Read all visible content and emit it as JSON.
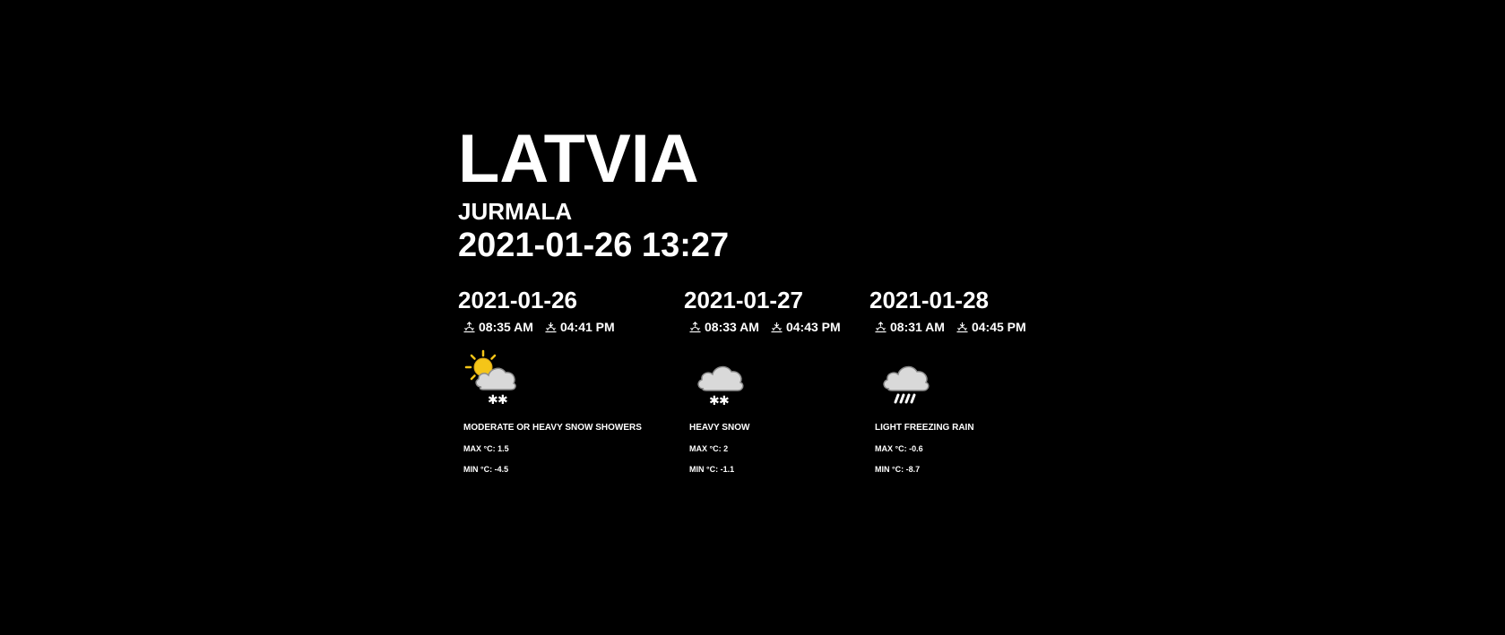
{
  "location": {
    "country": "LATVIA",
    "city": "JURMALA",
    "datetime": "2021-01-26 13:27"
  },
  "colors": {
    "background": "#000000",
    "text": "#ffffff",
    "sun": "#f5c518",
    "cloud": "#d9d9d9"
  },
  "forecast": [
    {
      "date": "2021-01-26",
      "sunrise": "08:35 AM",
      "sunset": "04:41 PM",
      "icon": "sun-cloud-snow-icon",
      "condition": "MODERATE OR HEAVY SNOW SHOWERS",
      "max": "MAX °C: 1.5",
      "min": "MIN °C: -4.5"
    },
    {
      "date": "2021-01-27",
      "sunrise": "08:33 AM",
      "sunset": "04:43 PM",
      "icon": "cloud-snow-icon",
      "condition": "HEAVY SNOW",
      "max": "MAX °C: 2",
      "min": "MIN °C: -1.1"
    },
    {
      "date": "2021-01-28",
      "sunrise": "08:31 AM",
      "sunset": "04:45 PM",
      "icon": "cloud-freezing-rain-icon",
      "condition": "LIGHT FREEZING RAIN",
      "max": "MAX °C: -0.6",
      "min": "MIN °C: -8.7"
    }
  ]
}
